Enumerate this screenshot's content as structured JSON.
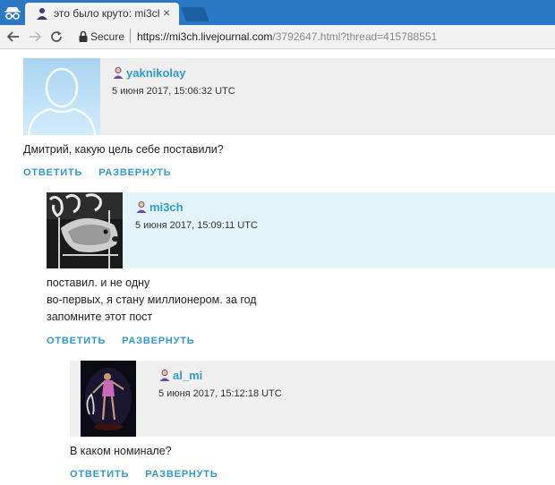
{
  "browser": {
    "tab_title": "это было круто: mi3ch",
    "tab_close": "×",
    "secure_label": "Secure",
    "url_host": "https://mi3ch.livejournal.com",
    "url_path": "/3792647.html?thread=415788551"
  },
  "comments": [
    {
      "username": "yaknikolay",
      "date": "5 июня 2017, 15:06:32 UTC",
      "lines": [
        "Дмитрий, какую цель себе поставили?"
      ],
      "actions": [
        "ОТВЕТИТЬ",
        "РАЗВЕРНУТЬ"
      ]
    },
    {
      "username": "mi3ch",
      "date": "5 июня 2017, 15:09:11 UTC",
      "lines": [
        "поставил. и не одну",
        "во-первых, я стану миллионером. за год",
        "запомните этот пост"
      ],
      "actions": [
        "ОТВЕТИТЬ",
        "РАЗВЕРНУТЬ"
      ]
    },
    {
      "username": "al_mi",
      "date": "5 июня 2017, 15:12:18 UTC",
      "lines": [
        "В каком номинале?"
      ],
      "actions": [
        "ОТВЕТИТЬ",
        "РАЗВЕРНУТЬ"
      ]
    }
  ],
  "colors": {
    "link": "#2f9ad2",
    "header_gray": "#efefef",
    "header_blue": "#e3f3fa",
    "chrome_blue": "#2b78c5"
  }
}
